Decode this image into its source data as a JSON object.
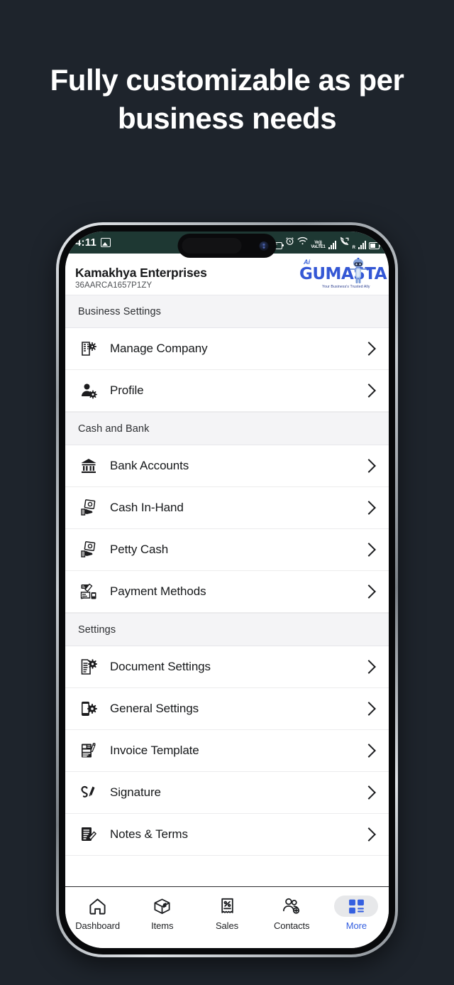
{
  "promo": {
    "headline": "Fully customizable as per business needs"
  },
  "colors": {
    "page_background": "#1e242c",
    "status_bar": "#1e3833",
    "accent_blue": "#3560e0",
    "logo_blue": "#3457d5",
    "section_header_bg": "#f4f4f6",
    "row_bg": "#ffffff"
  },
  "status_bar": {
    "time": "4:11",
    "left_icons": [
      "photo-icon"
    ],
    "network_label": "VoLTE1",
    "roaming_label": "R",
    "sim2_label": "2",
    "right_icons": [
      "battery-saver-icon",
      "alarm-icon",
      "wifi-icon",
      "volte-icon",
      "signal-bars-icon",
      "call-forward-icon",
      "signal-bars-icon",
      "battery-icon"
    ]
  },
  "header": {
    "business_name": "Kamakhya Enterprises",
    "gst_number": "36AARCA1657P1ZY",
    "logo": {
      "badge": "Ai",
      "wordmark": "GUMASTA",
      "tagline": "Your Business's Trusted Ally",
      "mascot": "robot-icon"
    }
  },
  "menu": {
    "sections": [
      {
        "title": "Business Settings",
        "items": [
          {
            "label": "Manage Company",
            "icon": "building-gear-icon"
          },
          {
            "label": "Profile",
            "icon": "person-gear-icon"
          }
        ]
      },
      {
        "title": "Cash and Bank",
        "items": [
          {
            "label": "Bank Accounts",
            "icon": "bank-icon"
          },
          {
            "label": "Cash In-Hand",
            "icon": "cash-hand-icon"
          },
          {
            "label": "Petty Cash",
            "icon": "cash-hand-icon"
          },
          {
            "label": "Payment Methods",
            "icon": "payment-methods-icon"
          }
        ]
      },
      {
        "title": "Settings",
        "items": [
          {
            "label": "Document Settings",
            "icon": "document-gear-icon"
          },
          {
            "label": "General Settings",
            "icon": "phone-gear-icon"
          },
          {
            "label": "Invoice Template",
            "icon": "invoice-template-icon"
          },
          {
            "label": "Signature",
            "icon": "signature-pen-icon"
          },
          {
            "label": "Notes & Terms",
            "icon": "notes-edit-icon"
          }
        ]
      }
    ],
    "chevron_icon": "chevron-right-icon"
  },
  "bottom_nav": {
    "items": [
      {
        "label": "Dashboard",
        "icon": "home-icon",
        "active": false
      },
      {
        "label": "Items",
        "icon": "box-icon",
        "active": false
      },
      {
        "label": "Sales",
        "icon": "receipt-icon",
        "active": false
      },
      {
        "label": "Contacts",
        "icon": "people-add-icon",
        "active": false
      },
      {
        "label": "More",
        "icon": "grid-menu-icon",
        "active": true
      }
    ]
  }
}
